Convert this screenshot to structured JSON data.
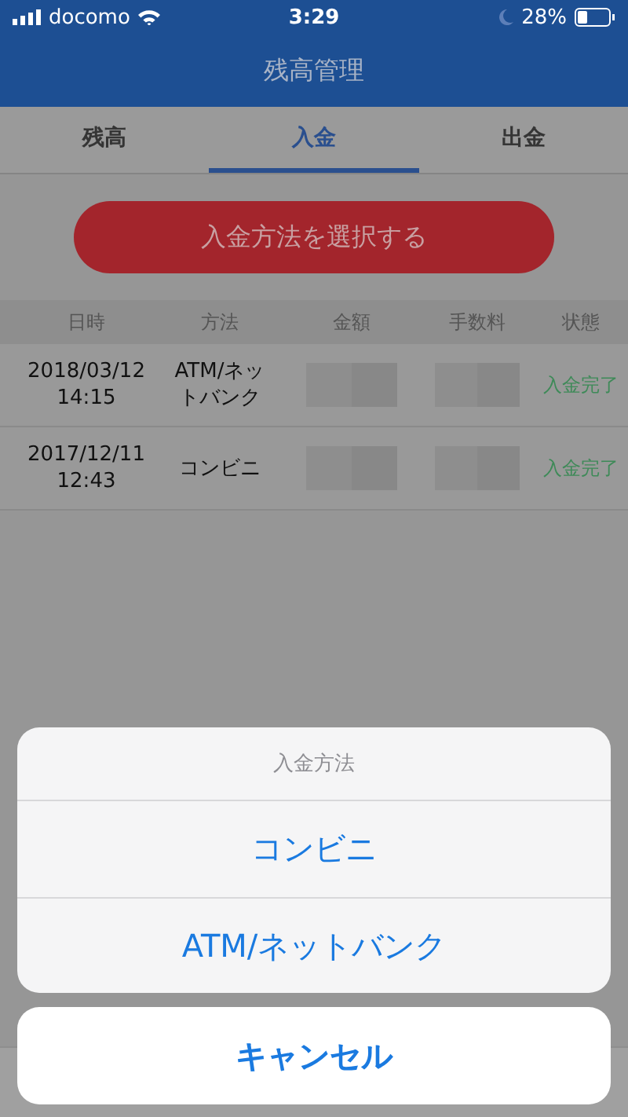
{
  "status_bar": {
    "carrier": "docomo",
    "time": "3:29",
    "battery": "28%"
  },
  "header": {
    "title": "残高管理"
  },
  "tabs": [
    {
      "label": "残高",
      "selected": false
    },
    {
      "label": "入金",
      "selected": true
    },
    {
      "label": "出金",
      "selected": false
    }
  ],
  "select_button": "入金方法を選択する",
  "table": {
    "columns": [
      "日時",
      "方法",
      "金額",
      "手数料",
      "状態"
    ],
    "rows": [
      {
        "datetime": "2018/03/12\n14:15",
        "method": "ATM/ネットバンク",
        "status": "入金完了"
      },
      {
        "datetime": "2017/12/11\n12:43",
        "method": "コンビニ",
        "status": "入金完了"
      }
    ]
  },
  "action_sheet": {
    "title": "入金方法",
    "options": [
      "コンビニ",
      "ATM/ネットバンク"
    ],
    "cancel": "キャンセル"
  }
}
